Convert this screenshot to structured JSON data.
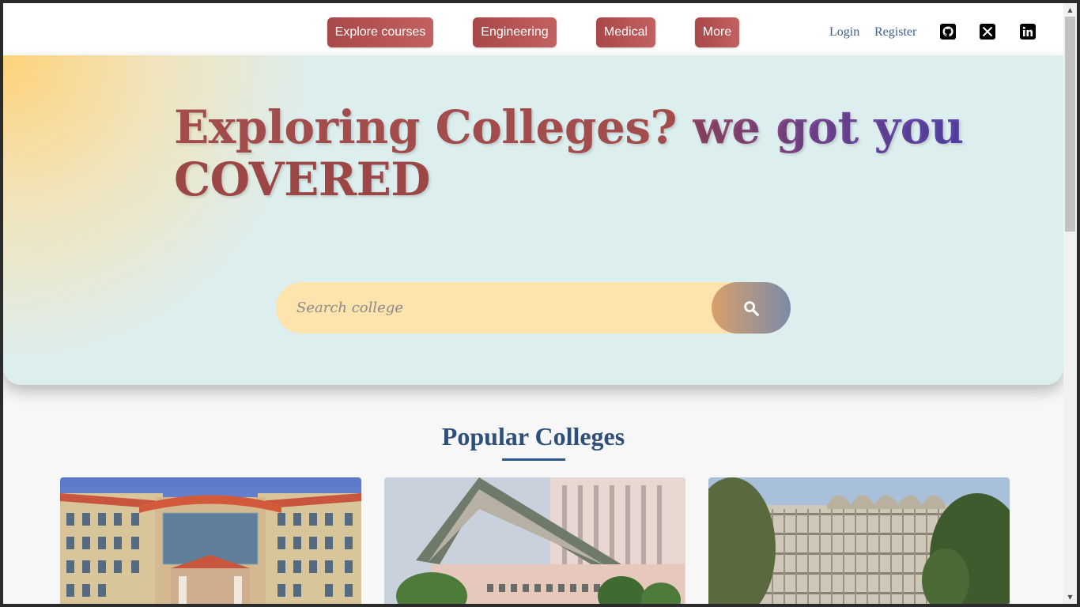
{
  "nav": {
    "buttons": [
      "Explore courses",
      "Engineering",
      "Medical",
      "More"
    ],
    "login": "Login",
    "register": "Register",
    "social_icons": [
      "github-icon",
      "x-twitter-icon",
      "linkedin-icon"
    ]
  },
  "hero": {
    "title_part1": "Exploring Colleges?",
    "title_part2": "we got you",
    "title_part3": "COVERED",
    "search_placeholder": "Search college",
    "search_icon": "search-icon"
  },
  "popular": {
    "title": "Popular Colleges",
    "cards": [
      {
        "image": "college-building-photo-1"
      },
      {
        "image": "college-building-photo-2"
      },
      {
        "image": "college-building-photo-3"
      }
    ]
  },
  "colors": {
    "nav_button": "#b05252",
    "link": "#3b5f8a",
    "heading": "#2d4f7a",
    "hero_bg": "#ddeeee",
    "search_bg": "#fde4ad"
  }
}
